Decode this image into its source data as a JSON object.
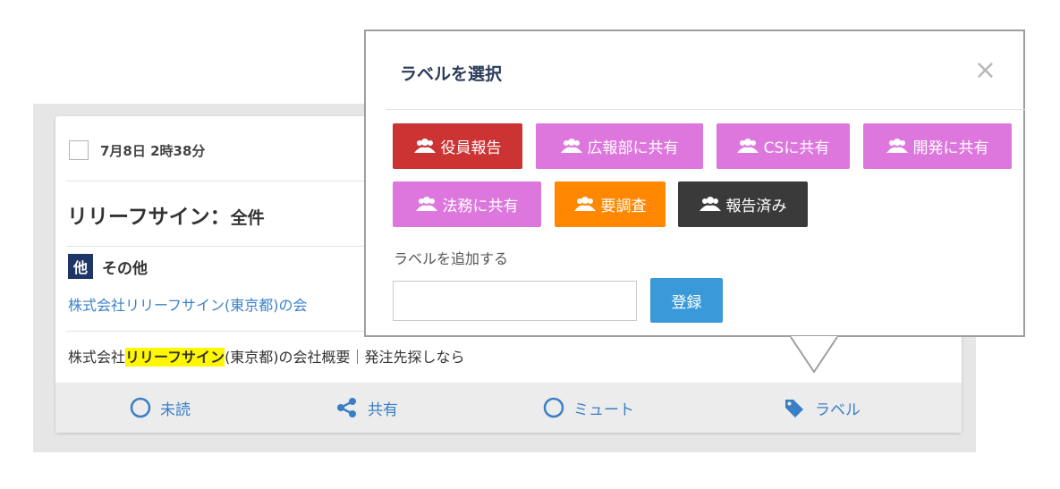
{
  "card": {
    "date": "7月8日 2時38分",
    "keyword": "リリーフサイン",
    "scope_separator": "：",
    "scope": "全件",
    "category_badge": "他",
    "category_name": "その他",
    "article_link": "株式会社リリーフサイン(東京都)の会",
    "snippet_prefix": "株式会社",
    "snippet_highlight": "リリーフサイン",
    "snippet_suffix": "(東京都)の会社概要｜発注先探しなら",
    "actions": {
      "unread": "未読",
      "share": "共有",
      "mute": "ミュート",
      "label": "ラベル"
    }
  },
  "popover": {
    "title": "ラベルを選択",
    "close_symbol": "×",
    "labels": [
      {
        "text": "役員報告",
        "color": "#cc3333"
      },
      {
        "text": "広報部に共有",
        "color": "#dd77dd"
      },
      {
        "text": "CSに共有",
        "color": "#dd77dd"
      },
      {
        "text": "開発に共有",
        "color": "#dd77dd"
      },
      {
        "text": "法務に共有",
        "color": "#dd77dd"
      },
      {
        "text": "要調査",
        "color": "#ff8800"
      },
      {
        "text": "報告済み",
        "color": "#3a3a3a"
      }
    ],
    "add_label_text": "ラベルを追加する",
    "input_value": "",
    "register_button": "登録"
  },
  "colors": {
    "link_blue": "#3a7fc6",
    "highlight": "#fff700",
    "category_badge": "#1e3565",
    "register_button": "#3a9ad9"
  },
  "icons": {
    "label_tag_icon": "users-icon",
    "unread": "circle-icon",
    "share": "share-icon",
    "mute": "circle-icon",
    "label": "tag-icon"
  }
}
